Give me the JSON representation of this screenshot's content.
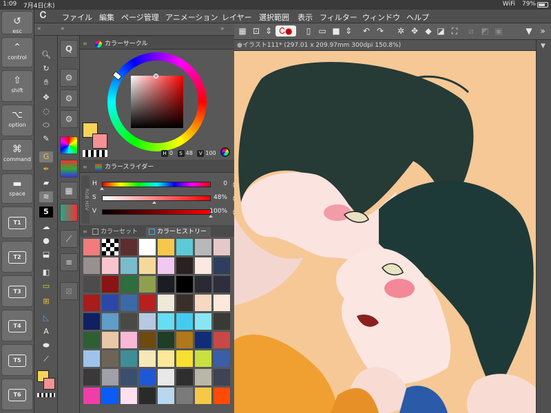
{
  "status_bar": {
    "time": "1:09",
    "date": "7月4日(木)",
    "wifi": "WiFi",
    "battery_text": "79%",
    "battery_level": 0.79
  },
  "edge_keys": [
    {
      "glyph": "↺",
      "label": "esc"
    },
    {
      "glyph": "⌃",
      "label": "control"
    },
    {
      "glyph": "⇧",
      "label": "shift"
    },
    {
      "glyph": "⌥",
      "label": "option"
    },
    {
      "glyph": "⌘",
      "label": "command"
    },
    {
      "glyph": "▬",
      "label": "space"
    },
    {
      "box": "T1"
    },
    {
      "box": "T2"
    },
    {
      "box": "T3"
    },
    {
      "box": "T4"
    },
    {
      "box": "T5"
    },
    {
      "box": "T6"
    }
  ],
  "menu": {
    "logo": "Ꮯ",
    "items": [
      "ファイル",
      "編集",
      "ページ管理",
      "アニメーション",
      "レイヤー",
      "選択範囲",
      "表示",
      "フィルター",
      "ウィンドウ",
      "ヘルプ"
    ]
  },
  "panels": {
    "circle_title": "カラーサークル",
    "slider_title": "カラースライダー",
    "history_tabs": [
      "カラーセット",
      "カラーヒストリー"
    ]
  },
  "color": {
    "main": "#f7d358",
    "sub": "#f49293",
    "hsv": {
      "H": "0",
      "S": "48",
      "V": "100"
    },
    "sliders": [
      {
        "label": "H",
        "value": "0",
        "pos": 0.0
      },
      {
        "label": "S",
        "value": "48%",
        "pos": 0.48
      },
      {
        "label": "V",
        "value": "100%",
        "pos": 1.0
      }
    ]
  },
  "history_swatches": [
    "#f27c7c",
    "checker",
    "#5c2e2e",
    "#ffffff",
    "#f5c84a",
    "#5ec9d6",
    "#b8b8b8",
    "#e6c8c8",
    "#9a8f8f",
    "#f9c4cc",
    "#7bbccc",
    "#f5d99a",
    "#f0c8f0",
    "#2a2220",
    "#fbe8e0",
    "#2e3e5e",
    "#4c4c4c",
    "#8a1414",
    "#2e6e3e",
    "#8ea04e",
    "#1c1c24",
    "#000000",
    "#2a2a34",
    "#2e2e3e",
    "#a81c1c",
    "#2a48a8",
    "#3a6aa8",
    "#b82020",
    "#f0e8d8",
    "#3a2e2a",
    "#f7d8c0",
    "#fde8dc",
    "#102060",
    "#5e9ec8",
    "#4a4a44",
    "#b8c8e0",
    "#66ddf4",
    "#44ccf0",
    "#88e6f4",
    "#3a3a34",
    "#2e5e34",
    "#e8c8a8",
    "#f9b8d8",
    "#6e4a10",
    "#1e3e28",
    "#b07818",
    "#102e78",
    "#c84848",
    "#9ec4ec",
    "#6e6456",
    "#3e8e98",
    "#f7e8b8",
    "#fce898",
    "#f8e030",
    "#c8e040",
    "#3a5ea8",
    "#3a3838",
    "#a0a0a8",
    "#3a4e6e",
    "#1e58d8",
    "#e8e8e8",
    "#2e2e2e",
    "#b8b8a8",
    "#3e4454",
    "#f03ea8",
    "#0a5cf4",
    "#fce0f0",
    "#2a2a2a",
    "#b8d8f0",
    "#7a7a7a",
    "#f7c848",
    "#ff4a08"
  ],
  "document": {
    "tab": "イラスト111* (297.01 x 209.97mm 300dpi 150.8%)"
  }
}
